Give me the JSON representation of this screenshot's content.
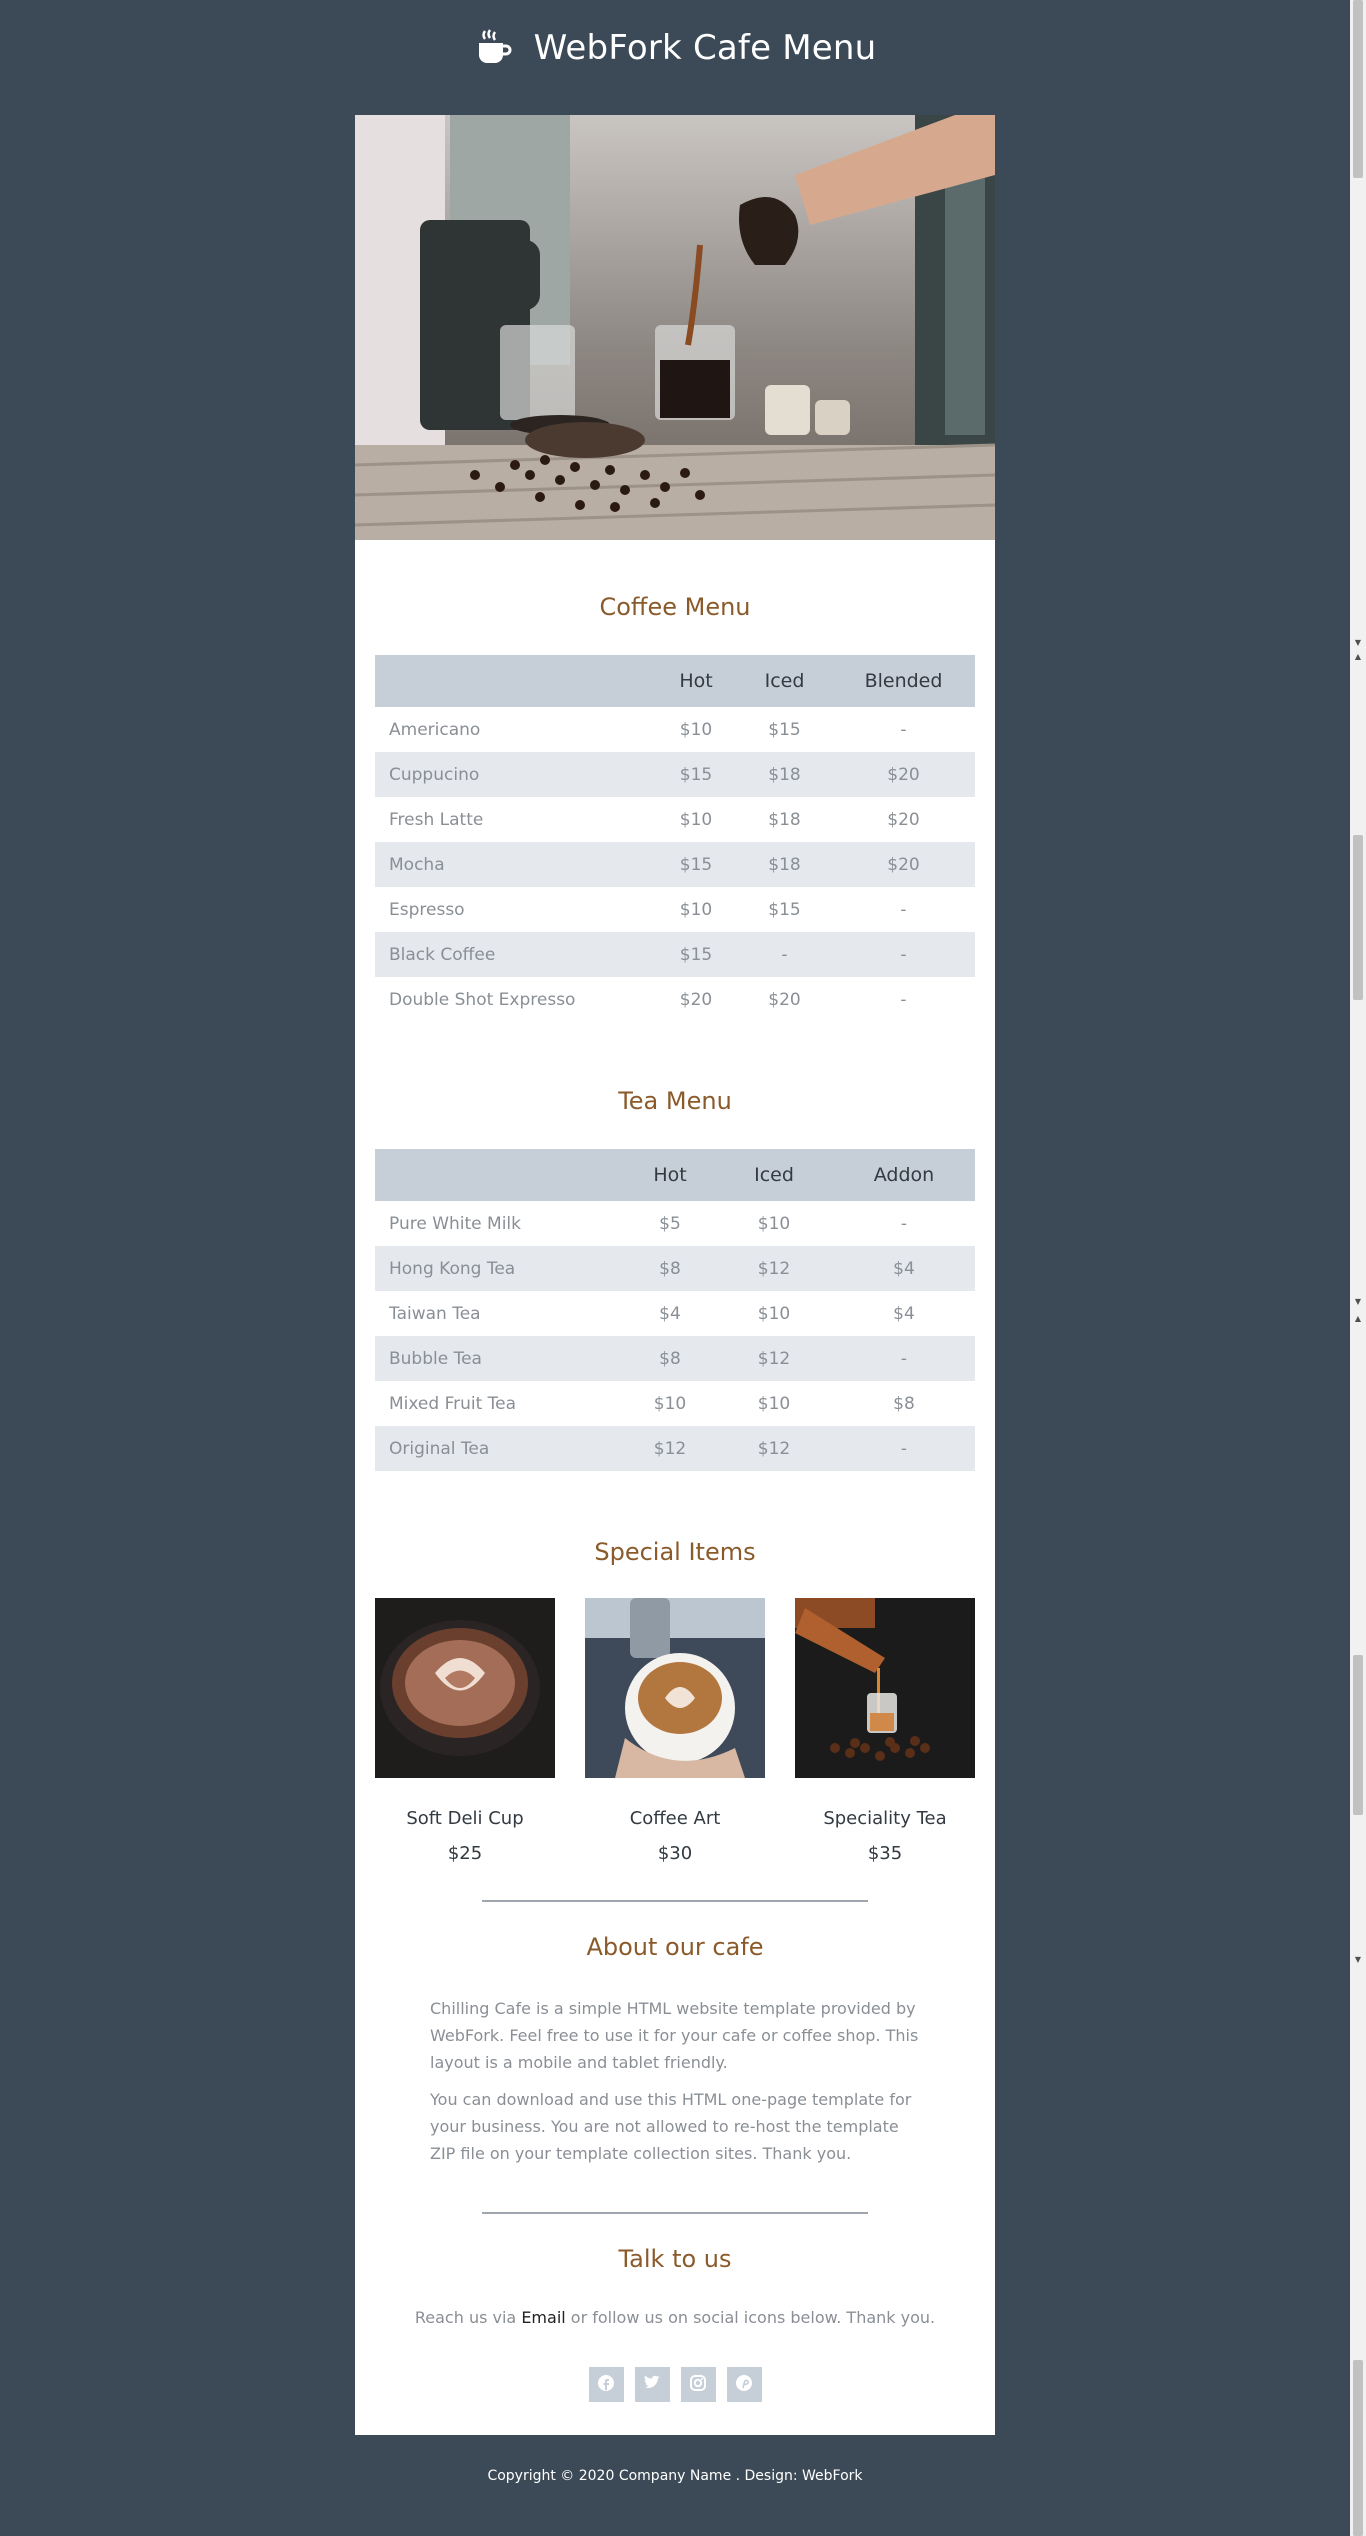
{
  "header": {
    "title": "WebFork Cafe Menu",
    "icon": "coffee-cup-icon"
  },
  "coffee": {
    "title": "Coffee Menu",
    "columns": [
      "",
      "Hot",
      "Iced",
      "Blended"
    ],
    "rows": [
      [
        "Americano",
        "$10",
        "$15",
        "-"
      ],
      [
        "Cuppucino",
        "$15",
        "$18",
        "$20"
      ],
      [
        "Fresh Latte",
        "$10",
        "$18",
        "$20"
      ],
      [
        "Mocha",
        "$15",
        "$18",
        "$20"
      ],
      [
        "Espresso",
        "$10",
        "$15",
        "-"
      ],
      [
        "Black Coffee",
        "$15",
        "-",
        "-"
      ],
      [
        "Double Shot Expresso",
        "$20",
        "$20",
        "-"
      ]
    ]
  },
  "tea": {
    "title": "Tea Menu",
    "columns": [
      "",
      "Hot",
      "Iced",
      "Addon"
    ],
    "rows": [
      [
        "Pure White Milk",
        "$5",
        "$10",
        "-"
      ],
      [
        "Hong Kong Tea",
        "$8",
        "$12",
        "$4"
      ],
      [
        "Taiwan Tea",
        "$4",
        "$10",
        "$4"
      ],
      [
        "Bubble Tea",
        "$8",
        "$12",
        "-"
      ],
      [
        "Mixed Fruit Tea",
        "$10",
        "$10",
        "$8"
      ],
      [
        "Original Tea",
        "$12",
        "$12",
        "-"
      ]
    ]
  },
  "special": {
    "title": "Special Items",
    "items": [
      {
        "name": "Soft Deli Cup",
        "price": "$25"
      },
      {
        "name": "Coffee Art",
        "price": "$30"
      },
      {
        "name": "Speciality Tea",
        "price": "$35"
      }
    ]
  },
  "about": {
    "title": "About our cafe",
    "p1": "Chilling Cafe is a simple HTML website template provided by WebFork. Feel free to use it for your cafe or coffee shop. This layout is a mobile and tablet friendly.",
    "p2": "You can download and use this HTML one-page template for your business. You are not allowed to re-host the template ZIP file on your template collection sites. Thank you."
  },
  "contact": {
    "title": "Talk to us",
    "before": "Reach us via ",
    "email": "Email",
    "after": " or follow us on social icons below. Thank you.",
    "socials": [
      "facebook-icon",
      "twitter-icon",
      "instagram-icon",
      "pinterest-icon"
    ]
  },
  "footer": {
    "text": "Copyright © 2020 Company Name . Design: WebFork"
  },
  "colors": {
    "background": "#3c4a57",
    "accent": "#8b5a2b",
    "table_header": "#c6ced8",
    "row_alt": "#e5e8ec"
  }
}
